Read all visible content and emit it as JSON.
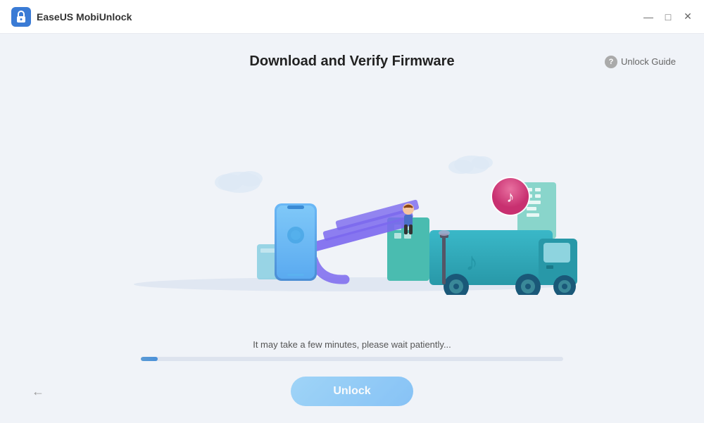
{
  "titleBar": {
    "appTitle": "EaseUS MobiUnlock",
    "controls": {
      "minimize": "—",
      "maximize": "□",
      "close": "✕"
    }
  },
  "header": {
    "pageTitle": "Download and Verify Firmware",
    "unlockGuideLabel": "Unlock Guide"
  },
  "progress": {
    "statusText": "It may take a few minutes, please wait patiently...",
    "percent": 4
  },
  "actions": {
    "backArrow": "←",
    "unlockLabel": "Unlock"
  },
  "colors": {
    "progressFill": "#4a8fd4",
    "unlockBtnGradStart": "#7ec8f7",
    "unlockBtnGradEnd": "#5baef5"
  }
}
